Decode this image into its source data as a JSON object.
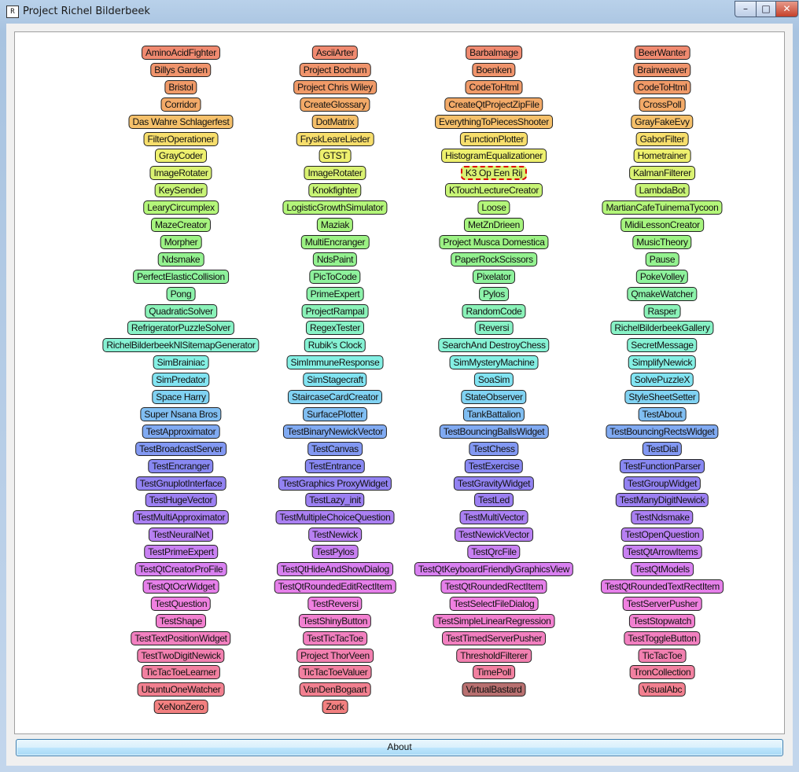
{
  "window": {
    "title": "Project Richel Bilderbeek",
    "app_icon": "R",
    "minimize": "–",
    "maximize": "□",
    "close": "✕"
  },
  "columns": [
    [
      {
        "label": "AminoAcidFighter",
        "color": "#f08a70"
      },
      {
        "label": "Billys Garden",
        "color": "#f0946c"
      },
      {
        "label": "Bristol",
        "color": "#f09a68"
      },
      {
        "label": "Corridor",
        "color": "#f3aa68"
      },
      {
        "label": "Das Wahre Schlagerfest",
        "color": "#f5c06a"
      },
      {
        "label": "FilterOperationer",
        "color": "#f7de6c"
      },
      {
        "label": "GrayCoder",
        "color": "#eef06e"
      },
      {
        "label": "ImageRotater",
        "color": "#daf272"
      },
      {
        "label": "KeySender",
        "color": "#c8f476"
      },
      {
        "label": "LearyCircumplex",
        "color": "#b4f67a"
      },
      {
        "label": "MazeCreator",
        "color": "#a6f47e"
      },
      {
        "label": "Morpher",
        "color": "#9cf284"
      },
      {
        "label": "Ndsmake",
        "color": "#94f290"
      },
      {
        "label": "PerfectElasticCollision",
        "color": "#8ef29c"
      },
      {
        "label": "Pong",
        "color": "#8cf2aa"
      },
      {
        "label": "QuadraticSolver",
        "color": "#8af2b8"
      },
      {
        "label": "RefrigeratorPuzzleSolver",
        "color": "#88f2c6"
      },
      {
        "label": "RichelBilderbeekNlSitemapGenerator",
        "color": "#86f2d4"
      },
      {
        "label": "SimBrainiac",
        "color": "#84f0e4"
      },
      {
        "label": "SimPredator",
        "color": "#82e4f2"
      },
      {
        "label": "Space Harry",
        "color": "#80d2f2"
      },
      {
        "label": "Super Nsana Bros",
        "color": "#80bef2"
      },
      {
        "label": "TestApproximator",
        "color": "#80aaf2"
      },
      {
        "label": "TestBroadcastServer",
        "color": "#8298f2"
      },
      {
        "label": "TestEncranger",
        "color": "#8888f2"
      },
      {
        "label": "TestGnuplotInterface",
        "color": "#9282f2"
      },
      {
        "label": "TestHugeVector",
        "color": "#9c80f2"
      },
      {
        "label": "TestMultiApproximator",
        "color": "#aa80f2"
      },
      {
        "label": "TestNeuralNet",
        "color": "#b880f2"
      },
      {
        "label": "TestPrimeExpert",
        "color": "#c880f2"
      },
      {
        "label": "TestQtCreatorProFile",
        "color": "#d880f0"
      },
      {
        "label": "TestQtOcrWidget",
        "color": "#e680ea"
      },
      {
        "label": "TestQuestion",
        "color": "#f080e0"
      },
      {
        "label": "TestShape",
        "color": "#f280d0"
      },
      {
        "label": "TestTextPositionWidget",
        "color": "#f280c0"
      },
      {
        "label": "TestTwoDigitNewick",
        "color": "#f280b0"
      },
      {
        "label": "TicTacToeLearner",
        "color": "#f280a0"
      },
      {
        "label": "UbuntuOneWatcher",
        "color": "#f28090"
      },
      {
        "label": "XeNonZero",
        "color": "#f28080"
      }
    ],
    [
      {
        "label": "AsciiArter",
        "color": "#f08a70"
      },
      {
        "label": "Project Bochum",
        "color": "#f0946c"
      },
      {
        "label": "Project Chris Wiley",
        "color": "#f09a68"
      },
      {
        "label": "CreateGlossary",
        "color": "#f3aa68"
      },
      {
        "label": "DotMatrix",
        "color": "#f5c06a"
      },
      {
        "label": "FryskLeareLieder",
        "color": "#f7de6c"
      },
      {
        "label": "GTST",
        "color": "#eef06e"
      },
      {
        "label": "ImageRotater",
        "color": "#daf272"
      },
      {
        "label": "Knokfighter",
        "color": "#c8f476"
      },
      {
        "label": "LogisticGrowthSimulator",
        "color": "#b4f67a"
      },
      {
        "label": "Maziak",
        "color": "#a6f47e"
      },
      {
        "label": "MultiEncranger",
        "color": "#9cf284"
      },
      {
        "label": "NdsPaint",
        "color": "#94f290"
      },
      {
        "label": "PicToCode",
        "color": "#8ef29c"
      },
      {
        "label": "PrimeExpert",
        "color": "#8cf2aa"
      },
      {
        "label": "ProjectRampal",
        "color": "#8af2b8"
      },
      {
        "label": "RegexTester",
        "color": "#88f2c6"
      },
      {
        "label": "Rubik's Clock",
        "color": "#86f2d4"
      },
      {
        "label": "SimImmuneResponse",
        "color": "#84f0e4"
      },
      {
        "label": "SimStagecraft",
        "color": "#82e4f2"
      },
      {
        "label": "StaircaseCardCreator",
        "color": "#80d2f2"
      },
      {
        "label": "SurfacePlotter",
        "color": "#80bef2"
      },
      {
        "label": "TestBinaryNewickVector",
        "color": "#80aaf2"
      },
      {
        "label": "TestCanvas",
        "color": "#8298f2"
      },
      {
        "label": "TestEntrance",
        "color": "#8888f2"
      },
      {
        "label": "TestGraphics ProxyWidget",
        "color": "#9282f2"
      },
      {
        "label": "TestLazy_init",
        "color": "#9c80f2"
      },
      {
        "label": "TestMultipleChoiceQuestion",
        "color": "#aa80f2"
      },
      {
        "label": "TestNewick",
        "color": "#b880f2"
      },
      {
        "label": "TestPylos",
        "color": "#c880f2"
      },
      {
        "label": "TestQtHideAndShowDialog",
        "color": "#d880f0"
      },
      {
        "label": "TestQtRoundedEditRectItem",
        "color": "#e680ea"
      },
      {
        "label": "TestReversi",
        "color": "#f080e0"
      },
      {
        "label": "TestShinyButton",
        "color": "#f280d0"
      },
      {
        "label": "TestTicTacToe",
        "color": "#f280c0"
      },
      {
        "label": "Project ThorVeen",
        "color": "#f280b0"
      },
      {
        "label": "TicTacToeValuer",
        "color": "#f280a0"
      },
      {
        "label": "VanDenBogaart",
        "color": "#f28090"
      },
      {
        "label": "Zork",
        "color": "#f28080"
      }
    ],
    [
      {
        "label": "Barbalmage",
        "color": "#f08a70"
      },
      {
        "label": "Boenken",
        "color": "#f0946c"
      },
      {
        "label": "CodeToHtml",
        "color": "#f09a68"
      },
      {
        "label": "CreateQtProjectZipFile",
        "color": "#f3aa68"
      },
      {
        "label": "EverythingToPiecesShooter",
        "color": "#f5c06a"
      },
      {
        "label": "FunctionPlotter",
        "color": "#f7de6c"
      },
      {
        "label": "HistogramEqualizationer",
        "color": "#eef06e"
      },
      {
        "label": "K3 Op Een Rij",
        "color": "#daf272",
        "selected": true
      },
      {
        "label": "KTouchLectureCreator",
        "color": "#c8f476"
      },
      {
        "label": "Loose",
        "color": "#b4f67a"
      },
      {
        "label": "MetZnDrieen",
        "color": "#a6f47e"
      },
      {
        "label": "Project Musca Domestica",
        "color": "#9cf284"
      },
      {
        "label": "PaperRockScissors",
        "color": "#94f290"
      },
      {
        "label": "Pixelator",
        "color": "#8ef29c"
      },
      {
        "label": "Pylos",
        "color": "#8cf2aa"
      },
      {
        "label": "RandomCode",
        "color": "#8af2b8"
      },
      {
        "label": "Reversi",
        "color": "#88f2c6"
      },
      {
        "label": "SearchAnd DestroyChess",
        "color": "#86f2d4"
      },
      {
        "label": "SimMysteryMachine",
        "color": "#84f0e4"
      },
      {
        "label": "SoaSim",
        "color": "#82e4f2"
      },
      {
        "label": "StateObserver",
        "color": "#80d2f2"
      },
      {
        "label": "TankBattalion",
        "color": "#80bef2"
      },
      {
        "label": "TestBouncingBallsWidget",
        "color": "#80aaf2"
      },
      {
        "label": "TestChess",
        "color": "#8298f2"
      },
      {
        "label": "TestExercise",
        "color": "#8888f2"
      },
      {
        "label": "TestGravityWidget",
        "color": "#9282f2"
      },
      {
        "label": "TestLed",
        "color": "#9c80f2"
      },
      {
        "label": "TestMultiVector",
        "color": "#aa80f2"
      },
      {
        "label": "TestNewickVector",
        "color": "#b880f2"
      },
      {
        "label": "TestQrcFile",
        "color": "#c880f2"
      },
      {
        "label": "TestQtKeyboardFriendlyGraphicsView",
        "color": "#d880f0"
      },
      {
        "label": "TestQtRoundedRectItem",
        "color": "#e680ea"
      },
      {
        "label": "TestSelectFileDialog",
        "color": "#f080e0"
      },
      {
        "label": "TestSimpleLinearRegression",
        "color": "#f280d0"
      },
      {
        "label": "TestTimedServerPusher",
        "color": "#f280c0"
      },
      {
        "label": "ThresholdFilterer",
        "color": "#f280b0"
      },
      {
        "label": "TimePoll",
        "color": "#f280a0"
      },
      {
        "label": "VirtualBastard",
        "color": "#b87070",
        "dark": true
      },
      {
        "label": "",
        "color": "transparent",
        "hidden": true
      }
    ],
    [
      {
        "label": "BeerWanter",
        "color": "#f08a70"
      },
      {
        "label": "Brainweaver",
        "color": "#f0946c"
      },
      {
        "label": "CodeToHtml",
        "color": "#f09a68"
      },
      {
        "label": "CrossPoll",
        "color": "#f3aa68"
      },
      {
        "label": "GrayFakeEvy",
        "color": "#f5c06a"
      },
      {
        "label": "GaborFilter",
        "color": "#f7de6c"
      },
      {
        "label": "Hometrainer",
        "color": "#eef06e"
      },
      {
        "label": "KalmanFilterer",
        "color": "#daf272"
      },
      {
        "label": "LambdaBot",
        "color": "#c8f476"
      },
      {
        "label": "MartianCafeTuinemaTycoon",
        "color": "#b4f67a"
      },
      {
        "label": "MidiLessonCreator",
        "color": "#a6f47e"
      },
      {
        "label": "MusicTheory",
        "color": "#9cf284"
      },
      {
        "label": "Pause",
        "color": "#94f290"
      },
      {
        "label": "PokeVolley",
        "color": "#8ef29c"
      },
      {
        "label": "QmakeWatcher",
        "color": "#8cf2aa"
      },
      {
        "label": "Rasper",
        "color": "#8af2b8"
      },
      {
        "label": "RichelBilderbeekGallery",
        "color": "#88f2c6"
      },
      {
        "label": "SecretMessage",
        "color": "#86f2d4"
      },
      {
        "label": "SimplifyNewick",
        "color": "#84f0e4"
      },
      {
        "label": "SolvePuzzleX",
        "color": "#82e4f2"
      },
      {
        "label": "StyleSheetSetter",
        "color": "#80d2f2"
      },
      {
        "label": "TestAbout",
        "color": "#80bef2"
      },
      {
        "label": "TestBouncingRectsWidget",
        "color": "#80aaf2"
      },
      {
        "label": "TestDial",
        "color": "#8298f2"
      },
      {
        "label": "TestFunctionParser",
        "color": "#8888f2"
      },
      {
        "label": "TestGroupWidget",
        "color": "#9282f2"
      },
      {
        "label": "TestManyDigitNewick",
        "color": "#9c80f2"
      },
      {
        "label": "TestNdsmake",
        "color": "#aa80f2"
      },
      {
        "label": "TestOpenQuestion",
        "color": "#b880f2"
      },
      {
        "label": "TestQtArrowItems",
        "color": "#c880f2"
      },
      {
        "label": "TestQtModels",
        "color": "#d880f0"
      },
      {
        "label": "TestQtRoundedTextRectItem",
        "color": "#e680ea"
      },
      {
        "label": "TestServerPusher",
        "color": "#f080e0"
      },
      {
        "label": "TestStopwatch",
        "color": "#f280d0"
      },
      {
        "label": "TestToggleButton",
        "color": "#f280c0"
      },
      {
        "label": "TicTacToe",
        "color": "#f280b0"
      },
      {
        "label": "TronCollection",
        "color": "#f280a0"
      },
      {
        "label": "VisualAbc",
        "color": "#f28090"
      },
      {
        "label": "",
        "color": "transparent",
        "hidden": true
      }
    ]
  ],
  "footer": {
    "about_label": "About"
  }
}
